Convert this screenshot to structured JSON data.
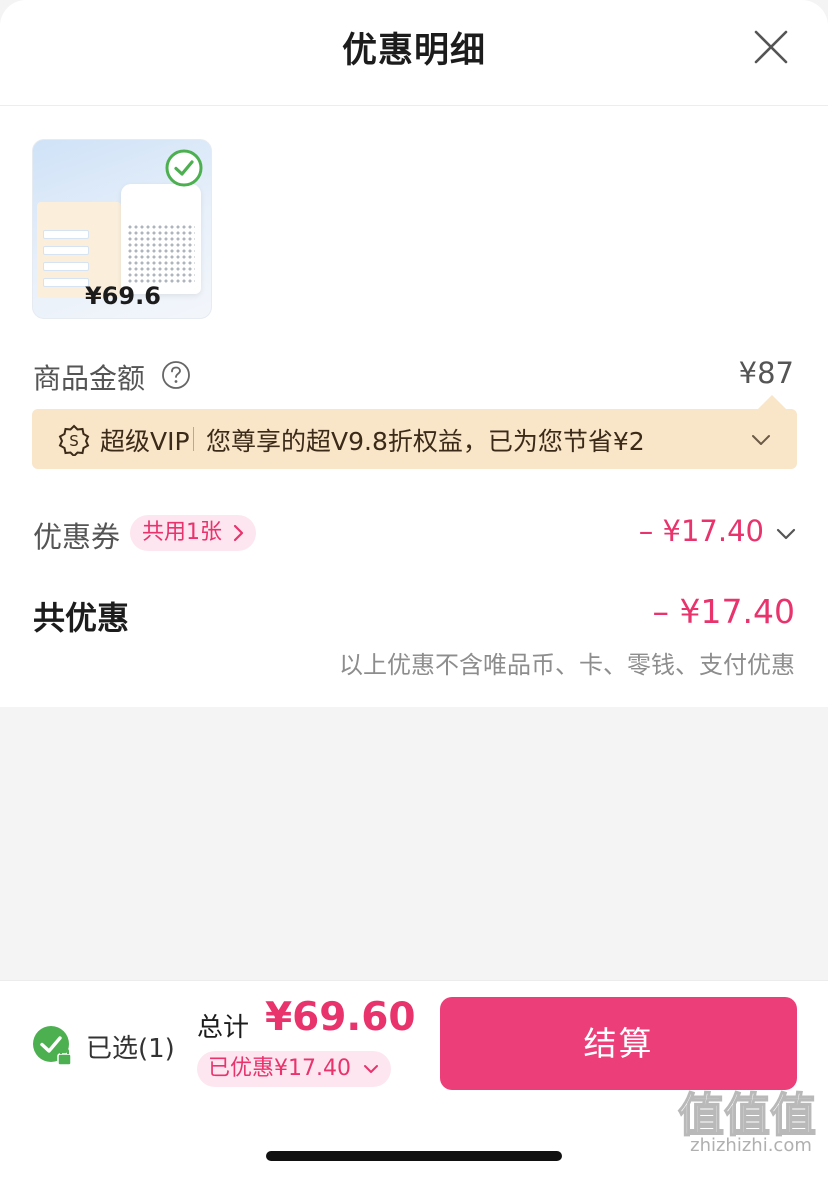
{
  "header": {
    "title": "优惠明细"
  },
  "product": {
    "price": "¥69.6"
  },
  "amount": {
    "label": "商品金额",
    "value": "¥87"
  },
  "vip": {
    "name": "超级VIP",
    "text": "您尊享的超V9.8折权益，已为您节省¥2"
  },
  "coupon": {
    "label": "优惠券",
    "chip": "共用1张",
    "value": "– ¥17.40"
  },
  "total": {
    "label": "共优惠",
    "value": "– ¥17.40",
    "note": "以上优惠不含唯品币、卡、零钱、支付优惠"
  },
  "footer": {
    "selected": "已选(1)",
    "sum_label": "总计",
    "sum_value": "¥69.60",
    "saved": "已优惠¥17.40",
    "checkout": "结算"
  },
  "colors": {
    "accent": "#e8336d",
    "checkout_bg": "#ec3f7a",
    "vip_bg": "#f9e5c8",
    "check_green": "#4caf50"
  },
  "icons": [
    "close-icon",
    "check-circle-icon",
    "help-circle-icon",
    "vip-badge-icon",
    "chevron-down-icon",
    "chevron-right-icon",
    "lock-icon"
  ],
  "watermark": {
    "text": "值值值",
    "url": "zhizhizhi.com"
  }
}
